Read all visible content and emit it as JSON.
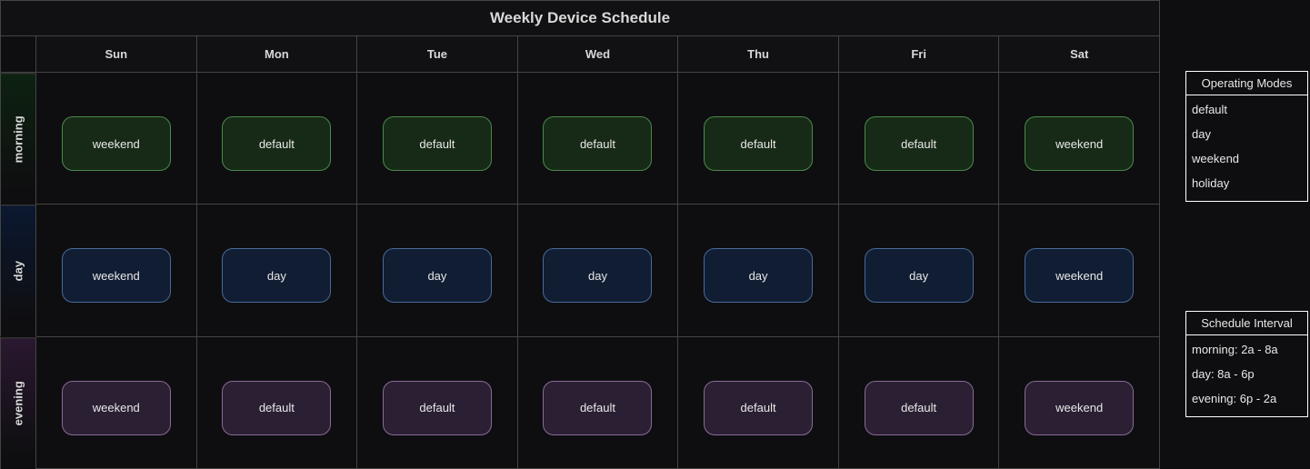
{
  "title": "Weekly Device Schedule",
  "days": [
    "Sun",
    "Mon",
    "Tue",
    "Wed",
    "Thu",
    "Fri",
    "Sat"
  ],
  "periods": [
    {
      "id": "morning",
      "label": "morning"
    },
    {
      "id": "day",
      "label": "day"
    },
    {
      "id": "evening",
      "label": "evening"
    }
  ],
  "cells": {
    "morning": [
      "weekend",
      "default",
      "default",
      "default",
      "default",
      "default",
      "weekend"
    ],
    "day": [
      "weekend",
      "day",
      "day",
      "day",
      "day",
      "day",
      "weekend"
    ],
    "evening": [
      "weekend",
      "default",
      "default",
      "default",
      "default",
      "default",
      "weekend"
    ]
  },
  "panels": {
    "modes": {
      "title": "Operating Modes",
      "items": [
        "default",
        "day",
        "weekend",
        "holiday"
      ]
    },
    "interval": {
      "title": "Schedule Interval",
      "items": [
        "morning: 2a - 8a",
        "day: 8a - 6p",
        "evening: 6p - 2a"
      ]
    }
  }
}
